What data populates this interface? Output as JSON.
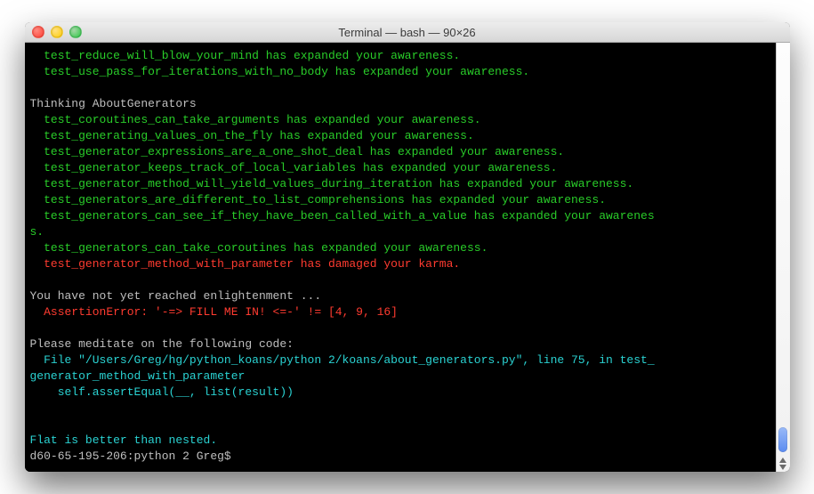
{
  "window": {
    "title": "Terminal — bash — 90×26"
  },
  "colors": {
    "pass": "#29cc29",
    "fail": "#ff3b30",
    "info": "#2ad2d2",
    "text": "#bfbfbf"
  },
  "terminal": {
    "lines": [
      {
        "indent": "  ",
        "text": "test_reduce_will_blow_your_mind has expanded your awareness.",
        "color": "green"
      },
      {
        "indent": "  ",
        "text": "test_use_pass_for_iterations_with_no_body has expanded your awareness.",
        "color": "green"
      },
      {
        "indent": "",
        "text": "",
        "color": "gray"
      },
      {
        "indent": "",
        "text": "Thinking AboutGenerators",
        "color": "gray"
      },
      {
        "indent": "  ",
        "text": "test_coroutines_can_take_arguments has expanded your awareness.",
        "color": "green"
      },
      {
        "indent": "  ",
        "text": "test_generating_values_on_the_fly has expanded your awareness.",
        "color": "green"
      },
      {
        "indent": "  ",
        "text": "test_generator_expressions_are_a_one_shot_deal has expanded your awareness.",
        "color": "green"
      },
      {
        "indent": "  ",
        "text": "test_generator_keeps_track_of_local_variables has expanded your awareness.",
        "color": "green"
      },
      {
        "indent": "  ",
        "text": "test_generator_method_will_yield_values_during_iteration has expanded your awareness.",
        "color": "green"
      },
      {
        "indent": "  ",
        "text": "test_generators_are_different_to_list_comprehensions has expanded your awareness.",
        "color": "green"
      },
      {
        "indent": "  ",
        "text": "test_generators_can_see_if_they_have_been_called_with_a_value has expanded your awarenes",
        "color": "green"
      },
      {
        "indent": "",
        "text": "s.",
        "color": "green"
      },
      {
        "indent": "  ",
        "text": "test_generators_can_take_coroutines has expanded your awareness.",
        "color": "green"
      },
      {
        "indent": "  ",
        "text": "test_generator_method_with_parameter has damaged your karma.",
        "color": "red"
      },
      {
        "indent": "",
        "text": "",
        "color": "gray"
      },
      {
        "indent": "",
        "text": "You have not yet reached enlightenment ...",
        "color": "gray"
      },
      {
        "indent": "  ",
        "text": "AssertionError: '-=> FILL ME IN! <=-' != [4, 9, 16]",
        "color": "red"
      },
      {
        "indent": "",
        "text": "",
        "color": "gray"
      },
      {
        "indent": "",
        "text": "Please meditate on the following code:",
        "color": "gray"
      },
      {
        "indent": "  ",
        "text": "File \"/Users/Greg/hg/python_koans/python 2/koans/about_generators.py\", line 75, in test_",
        "color": "cyan"
      },
      {
        "indent": "",
        "text": "generator_method_with_parameter",
        "color": "cyan"
      },
      {
        "indent": "    ",
        "text": "self.assertEqual(__, list(result))",
        "color": "cyan"
      },
      {
        "indent": "",
        "text": "",
        "color": "gray"
      },
      {
        "indent": "",
        "text": "",
        "color": "gray"
      },
      {
        "indent": "",
        "text": "Flat is better than nested.",
        "color": "cyan"
      },
      {
        "indent": "",
        "text": "d60-65-195-206:python 2 Greg$ ",
        "color": "gray"
      }
    ]
  }
}
